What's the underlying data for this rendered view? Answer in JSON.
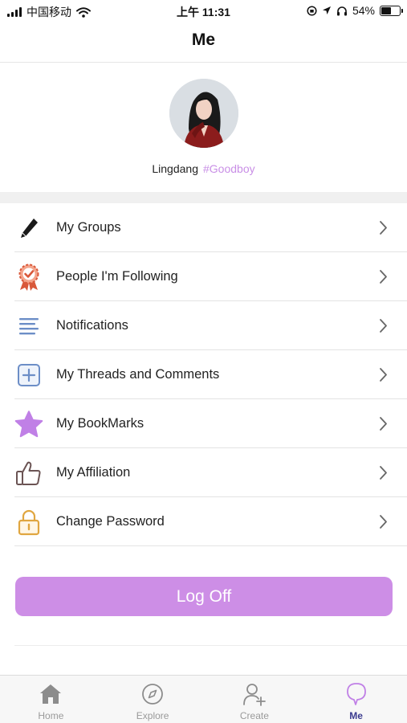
{
  "status_bar": {
    "carrier": "中国移动",
    "time": "上午 11:31",
    "battery": "54%",
    "battery_level": 0.54
  },
  "header": {
    "title": "Me"
  },
  "profile": {
    "name": "Lingdang",
    "tag": "#Goodboy"
  },
  "menu": {
    "items": [
      {
        "label": "My Groups",
        "icon": "pencil-icon"
      },
      {
        "label": "People I'm Following",
        "icon": "ribbon-badge-icon"
      },
      {
        "label": "Notifications",
        "icon": "lines-icon"
      },
      {
        "label": "My Threads and Comments",
        "icon": "plus-square-icon"
      },
      {
        "label": "My BookMarks",
        "icon": "star-icon"
      },
      {
        "label": "My Affiliation",
        "icon": "thumbs-up-icon"
      },
      {
        "label": "Change Password",
        "icon": "lock-icon"
      }
    ]
  },
  "logoff": {
    "label": "Log Off",
    "color": "#cd8ee6"
  },
  "tabs": [
    {
      "label": "Home",
      "icon": "home-icon"
    },
    {
      "label": "Explore",
      "icon": "compass-icon"
    },
    {
      "label": "Create",
      "icon": "add-user-icon"
    },
    {
      "label": "Me",
      "icon": "chat-bubble-icon",
      "active": true
    }
  ],
  "colors": {
    "accent": "#cd8ee6",
    "tab_active": "#3b3b8f",
    "tab_inactive": "#9a9a9a"
  }
}
